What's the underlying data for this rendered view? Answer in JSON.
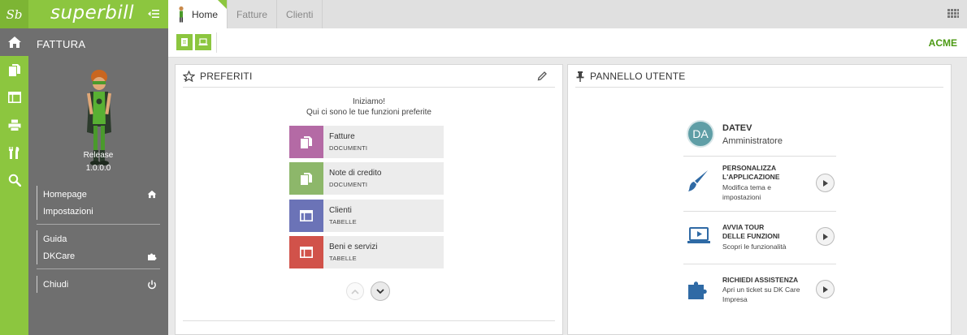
{
  "brand": {
    "mini": "Sb",
    "name": "superbill"
  },
  "tabs": [
    {
      "label": "Home"
    },
    {
      "label": "Fatture"
    },
    {
      "label": "Clienti"
    }
  ],
  "sidebar": {
    "section_title": "FATTURA",
    "release_label": "Release",
    "release_version": "1.0.0.0",
    "menu": [
      {
        "label": "Homepage",
        "icon": "home-icon"
      },
      {
        "label": "Impostazioni",
        "icon": ""
      },
      {
        "label": "Guida",
        "icon": ""
      },
      {
        "label": "DKCare",
        "icon": "puzzle-icon"
      },
      {
        "label": "Chiudi",
        "icon": "power-icon"
      }
    ],
    "icons": [
      "home-icon",
      "documents-icon",
      "table-icon",
      "printer-icon",
      "tools-icon",
      "search-icon"
    ]
  },
  "toolbar": {
    "company": "ACME"
  },
  "favorites": {
    "title": "PREFERITI",
    "intro_line1": "Iniziamo!",
    "intro_line2": "Qui ci sono le tue funzioni preferite",
    "items": [
      {
        "name": "Fatture",
        "category": "DOCUMENTI",
        "color": "#b46aa5"
      },
      {
        "name": "Note di credito",
        "category": "DOCUMENTI",
        "color": "#8db76a"
      },
      {
        "name": "Clienti",
        "category": "TABELLE",
        "color": "#6b73b7"
      },
      {
        "name": "Beni e servizi",
        "category": "TABELLE",
        "color": "#d1524a"
      }
    ]
  },
  "user_panel": {
    "title": "PANNELLO UTENTE",
    "avatar": "DA",
    "name": "DATEV",
    "role": "Amministratore",
    "actions": [
      {
        "title1": "PERSONALIZZA",
        "title2": "L'APPLICAZIONE",
        "desc1": "Modifica tema e",
        "desc2": "impostazioni"
      },
      {
        "title1": "AVVIA TOUR",
        "title2": "DELLE FUNZIONI",
        "desc1": "Scopri le funzionalità",
        "desc2": ""
      },
      {
        "title1": "RICHIEDI ASSISTENZA",
        "title2": "",
        "desc1": "Apri un ticket su DK Care",
        "desc2": "Impresa"
      }
    ]
  },
  "colors": {
    "brand_green": "#8cc63f",
    "sidebar_gray": "#6f6f6f",
    "company_green": "#4c9a14",
    "icon_blue": "#2f6aa5"
  }
}
